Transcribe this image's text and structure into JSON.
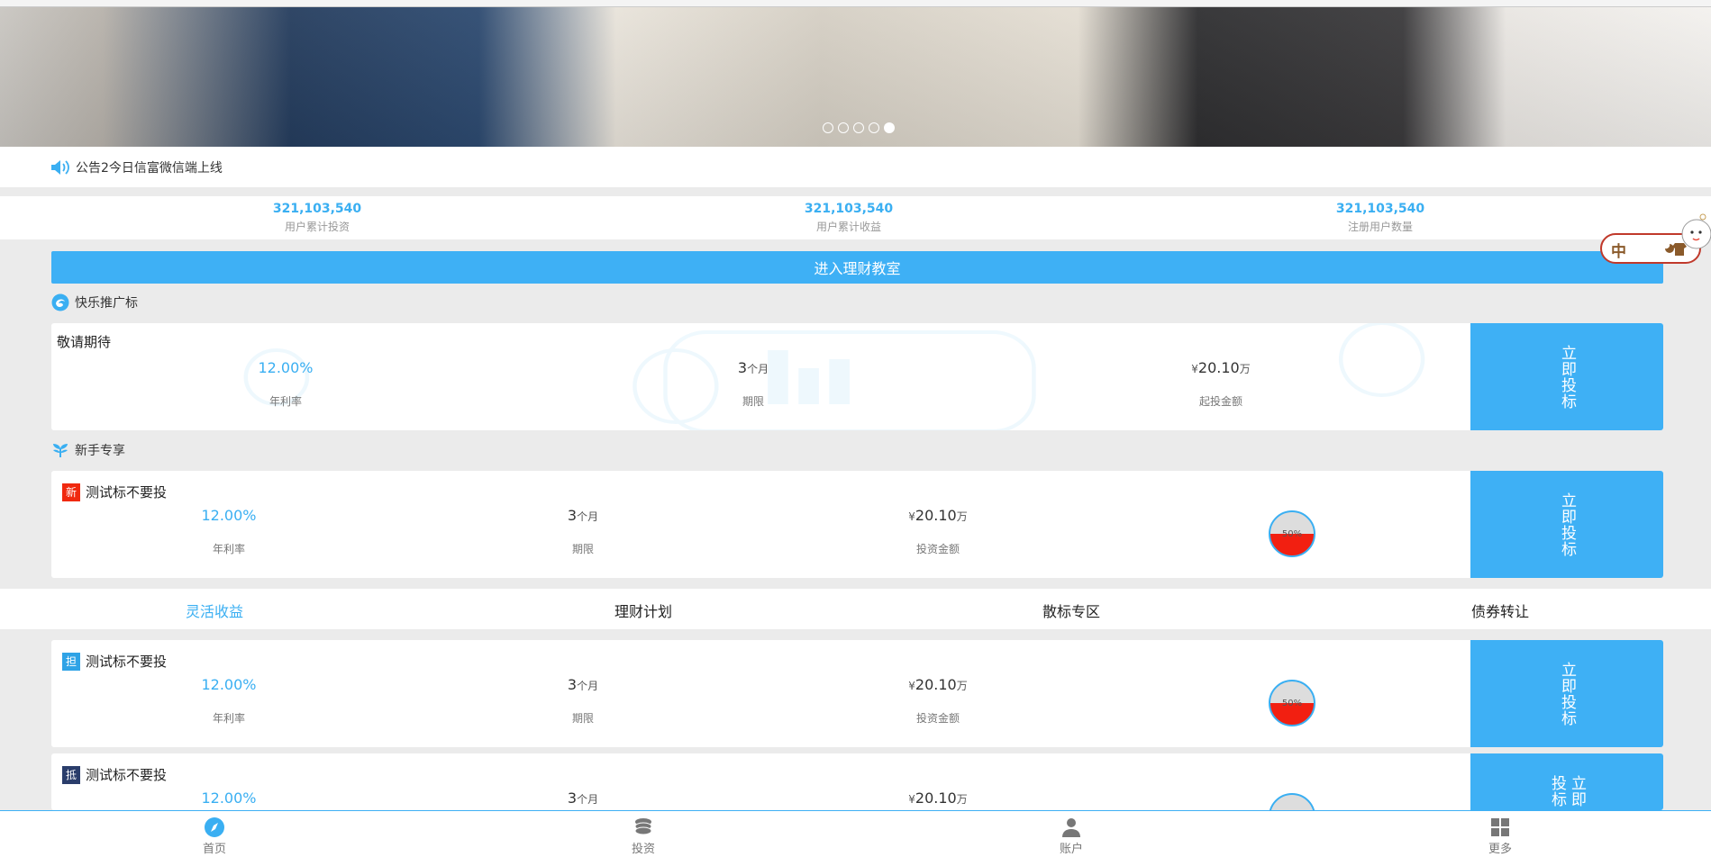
{
  "notice": {
    "text": "公告2今日信富微信端上线",
    "icon": "speaker-icon"
  },
  "banner": {
    "dot_count": 5,
    "active_index": 4
  },
  "stats": [
    {
      "value": "321,103,540",
      "label": "用户累计投资"
    },
    {
      "value": "321,103,540",
      "label": "用户累计收益"
    },
    {
      "value": "321,103,540",
      "label": "注册用户数量"
    }
  ],
  "classroom_button": "进入理财教室",
  "promo_section": {
    "title": "快乐推广标",
    "card": {
      "title": "敬请期待",
      "rate": "12.00%",
      "rate_label": "年利率",
      "term_num": "3",
      "term_unit": "个月",
      "term_label": "期限",
      "amount_prefix": "¥",
      "amount": "20.10",
      "amount_unit": "万",
      "amount_label": "起投金额",
      "button": "立即投标"
    }
  },
  "newbie_section": {
    "title": "新手专享",
    "card": {
      "tag": "新",
      "tag_color": "#f0290f",
      "title": "测试标不要投",
      "rate": "12.00%",
      "rate_label": "年利率",
      "term_num": "3",
      "term_unit": "个月",
      "term_label": "期限",
      "amount_prefix": "¥",
      "amount": "20.10",
      "amount_unit": "万",
      "amount_label": "投资金额",
      "progress": "50%",
      "progress_value": 0.5,
      "button": "立即投标"
    }
  },
  "tabs": [
    {
      "label": "灵活收益",
      "active": true
    },
    {
      "label": "理财计划",
      "active": false
    },
    {
      "label": "散标专区",
      "active": false
    },
    {
      "label": "债券转让",
      "active": false
    }
  ],
  "list": [
    {
      "tag": "担",
      "tag_color": "#2fa3e6",
      "title": "测试标不要投",
      "rate": "12.00%",
      "rate_label": "年利率",
      "term_num": "3",
      "term_unit": "个月",
      "term_label": "期限",
      "amount_prefix": "¥",
      "amount": "20.10",
      "amount_unit": "万",
      "amount_label": "投资金额",
      "progress": "50%",
      "progress_value": 0.5,
      "button": "立即投标"
    },
    {
      "tag": "抵",
      "tag_color": "#2a3d6b",
      "title": "测试标不要投",
      "rate": "12.00%",
      "term_num": "3",
      "term_unit": "个月",
      "amount_prefix": "¥",
      "amount": "20.10",
      "amount_unit": "万",
      "button": "立即投标"
    }
  ],
  "bottom_nav": [
    {
      "label": "首页",
      "icon": "compass-icon",
      "active": true
    },
    {
      "label": "投资",
      "icon": "coins-icon",
      "active": false
    },
    {
      "label": "账户",
      "icon": "user-icon",
      "active": false
    },
    {
      "label": "更多",
      "icon": "grid-icon",
      "active": false
    }
  ],
  "floating_widget": {
    "text": "中",
    "icons": [
      "moon-icon",
      "shirt-icon"
    ]
  },
  "colors": {
    "accent": "#3eb0f5",
    "text_blue": "#3aaff2",
    "bg": "#ebebeb"
  }
}
